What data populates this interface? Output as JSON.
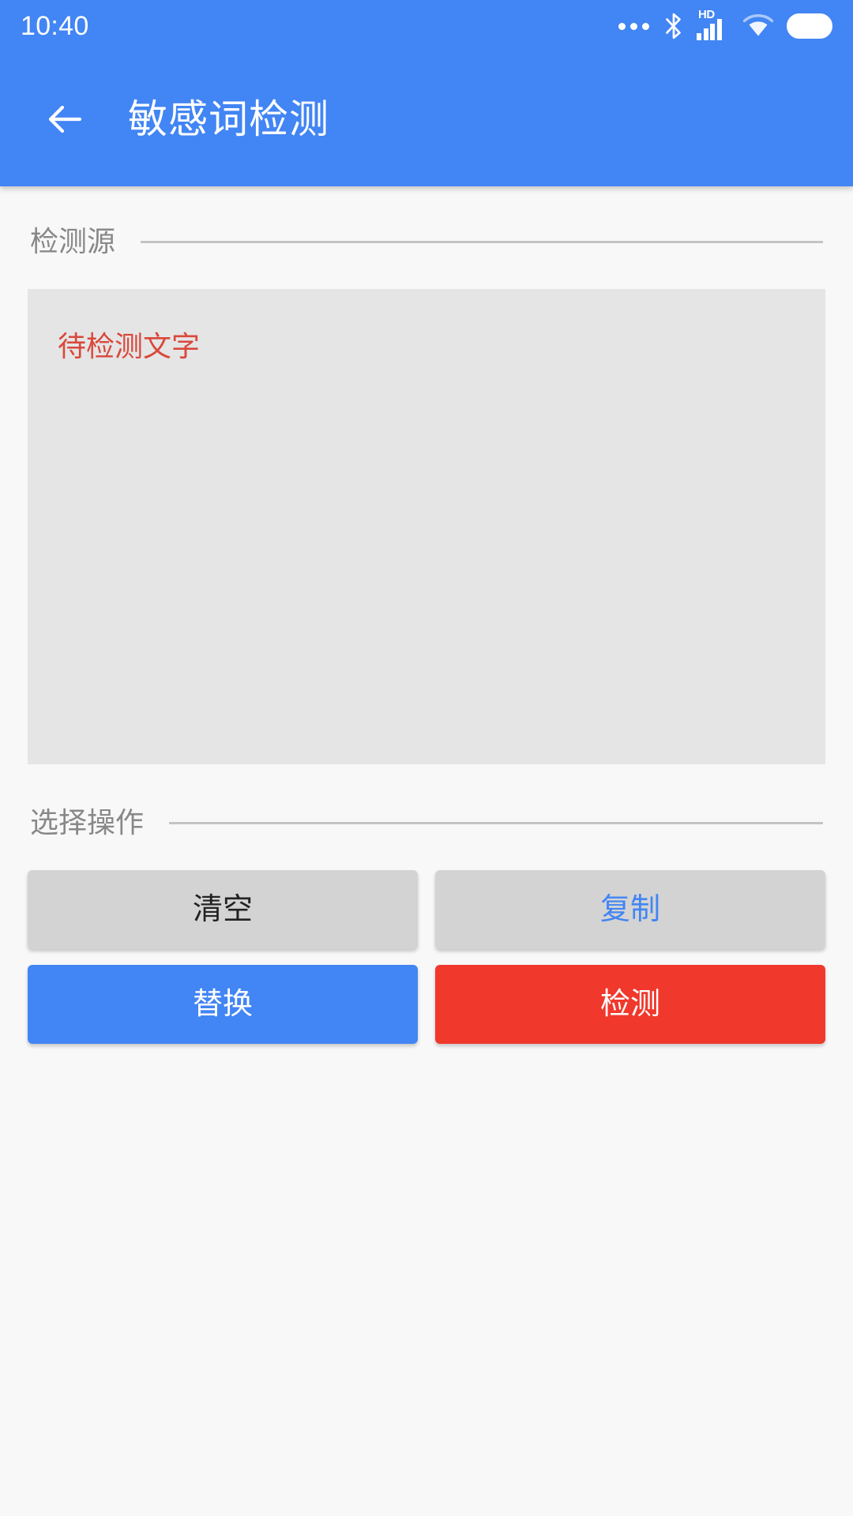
{
  "status_bar": {
    "time": "10:40",
    "icons": [
      {
        "name": "more-dots-icon"
      },
      {
        "name": "bluetooth-icon"
      },
      {
        "name": "hd-signal-icon",
        "hd_label": "HD"
      },
      {
        "name": "wifi-icon"
      },
      {
        "name": "battery-charging-icon"
      }
    ]
  },
  "app_bar": {
    "back_icon": "arrow-left-icon",
    "title": "敏感词检测"
  },
  "sections": {
    "source": {
      "label": "检测源",
      "textarea_placeholder": "待检测文字",
      "textarea_value": ""
    },
    "operations": {
      "label": "选择操作",
      "buttons": [
        {
          "label": "清空",
          "style": "grey-dark"
        },
        {
          "label": "复制",
          "style": "grey-blue"
        },
        {
          "label": "替换",
          "style": "blue"
        },
        {
          "label": "检测",
          "style": "red"
        }
      ]
    }
  },
  "colors": {
    "primary_blue": "#4285f4",
    "danger_red": "#f0382c",
    "placeholder_red": "#d9483b",
    "button_grey": "#d3d3d3",
    "textarea_grey": "#e5e5e5",
    "page_background": "#f8f8f8",
    "battery_green": "#3fc23f"
  }
}
